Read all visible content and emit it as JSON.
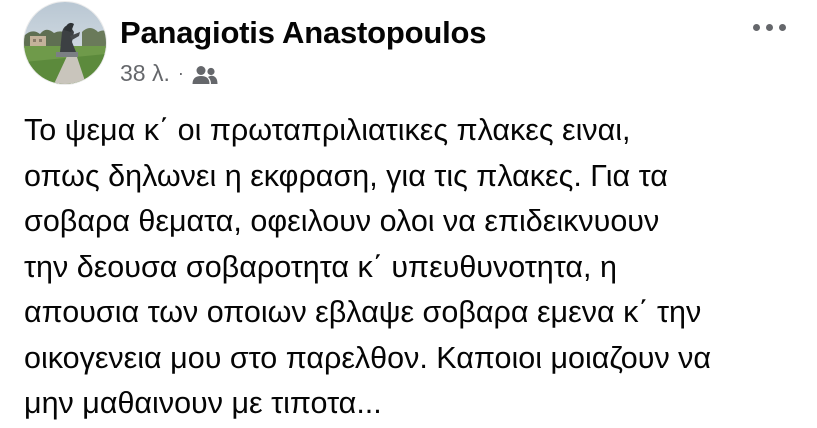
{
  "post": {
    "author": {
      "name": "Panagiotis Anastopoulos",
      "avatar_icon": "profile-photo-outdoor-sculpture"
    },
    "meta": {
      "time": "38 λ.",
      "separator": "·",
      "audience_icon": "friends-icon"
    },
    "more_icon": "more-options-icon",
    "text": "Το ψεμα κ΄ οι πρωταπριλιατικες πλακες ειναι,\nοπως δηλωνει η εκφραση, για τις πλακες. Για τα\nσοβαρα θεματα, οφειλουν ολοι να επιδεικνυουν\nτην δεουσα σοβαροτητα κ΄ υπευθυνοτητα, η\nαπουσια των οποιων εβλαψε σοβαρα εμενα κ΄ την\nοικογενεια μου στο παρελθον. Καποιοι μοιαζουν να\nμην μαθαινουν με τιποτα..."
  },
  "colors": {
    "text_primary": "#050505",
    "text_secondary": "#65676b",
    "background": "#ffffff"
  }
}
